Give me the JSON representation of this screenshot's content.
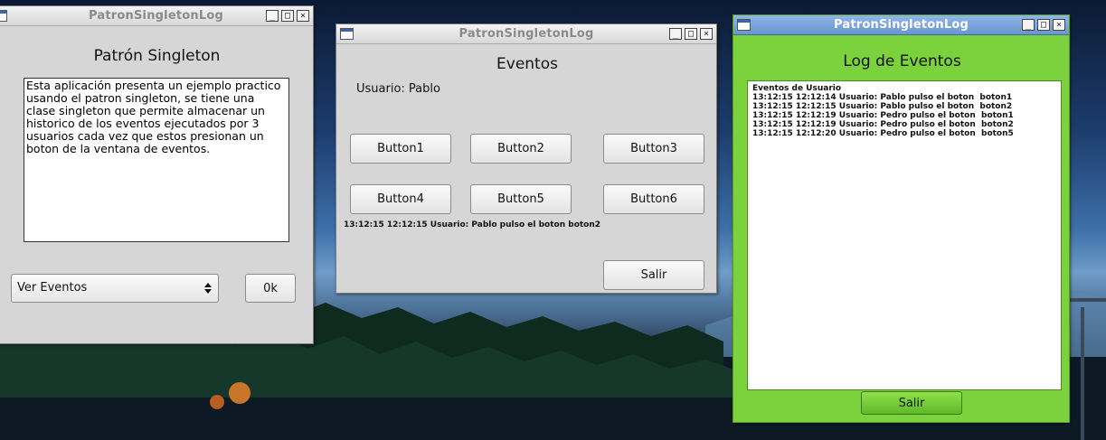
{
  "desktop": {
    "wallpaper": "mountain-lake-forest"
  },
  "win1": {
    "title": "PatronSingletonLog",
    "heading": "Patrón Singleton",
    "description": "Esta aplicación presenta un ejemplo practico\nusando el patron singleton, se tiene una\nclase singleton que permite almacenar un\nhistorico de los eventos ejecutados por 3\nusuarios cada vez que estos presionan un\nboton de la ventana de eventos.",
    "select_value": "Ver Eventos",
    "ok_label": "0k"
  },
  "win2": {
    "title": "PatronSingletonLog",
    "heading": "Eventos",
    "user_label": "Usuario: Pablo",
    "buttons": [
      "Button1",
      "Button2",
      "Button3",
      "Button4",
      "Button5",
      "Button6"
    ],
    "status_line": "13:12:15 12:12:15 Usuario: Pablo pulso el boton  boton2",
    "exit_label": "Salir"
  },
  "win3": {
    "title": "PatronSingletonLog",
    "heading": "Log de Eventos",
    "log_text": "Eventos de Usuario\n13:12:15 12:12:14 Usuario: Pablo pulso el boton  boton1\n13:12:15 12:12:15 Usuario: Pablo pulso el boton  boton2\n13:12:15 12:12:19 Usuario: Pedro pulso el boton  boton1\n13:12:15 12:12:19 Usuario: Pedro pulso el boton  boton2\n13:12:15 12:12:20 Usuario: Pedro pulso el boton  boton5",
    "exit_label": "Salir"
  },
  "colors": {
    "log_window_bg": "#7bd23c",
    "window_bg": "#d6d6d6"
  }
}
